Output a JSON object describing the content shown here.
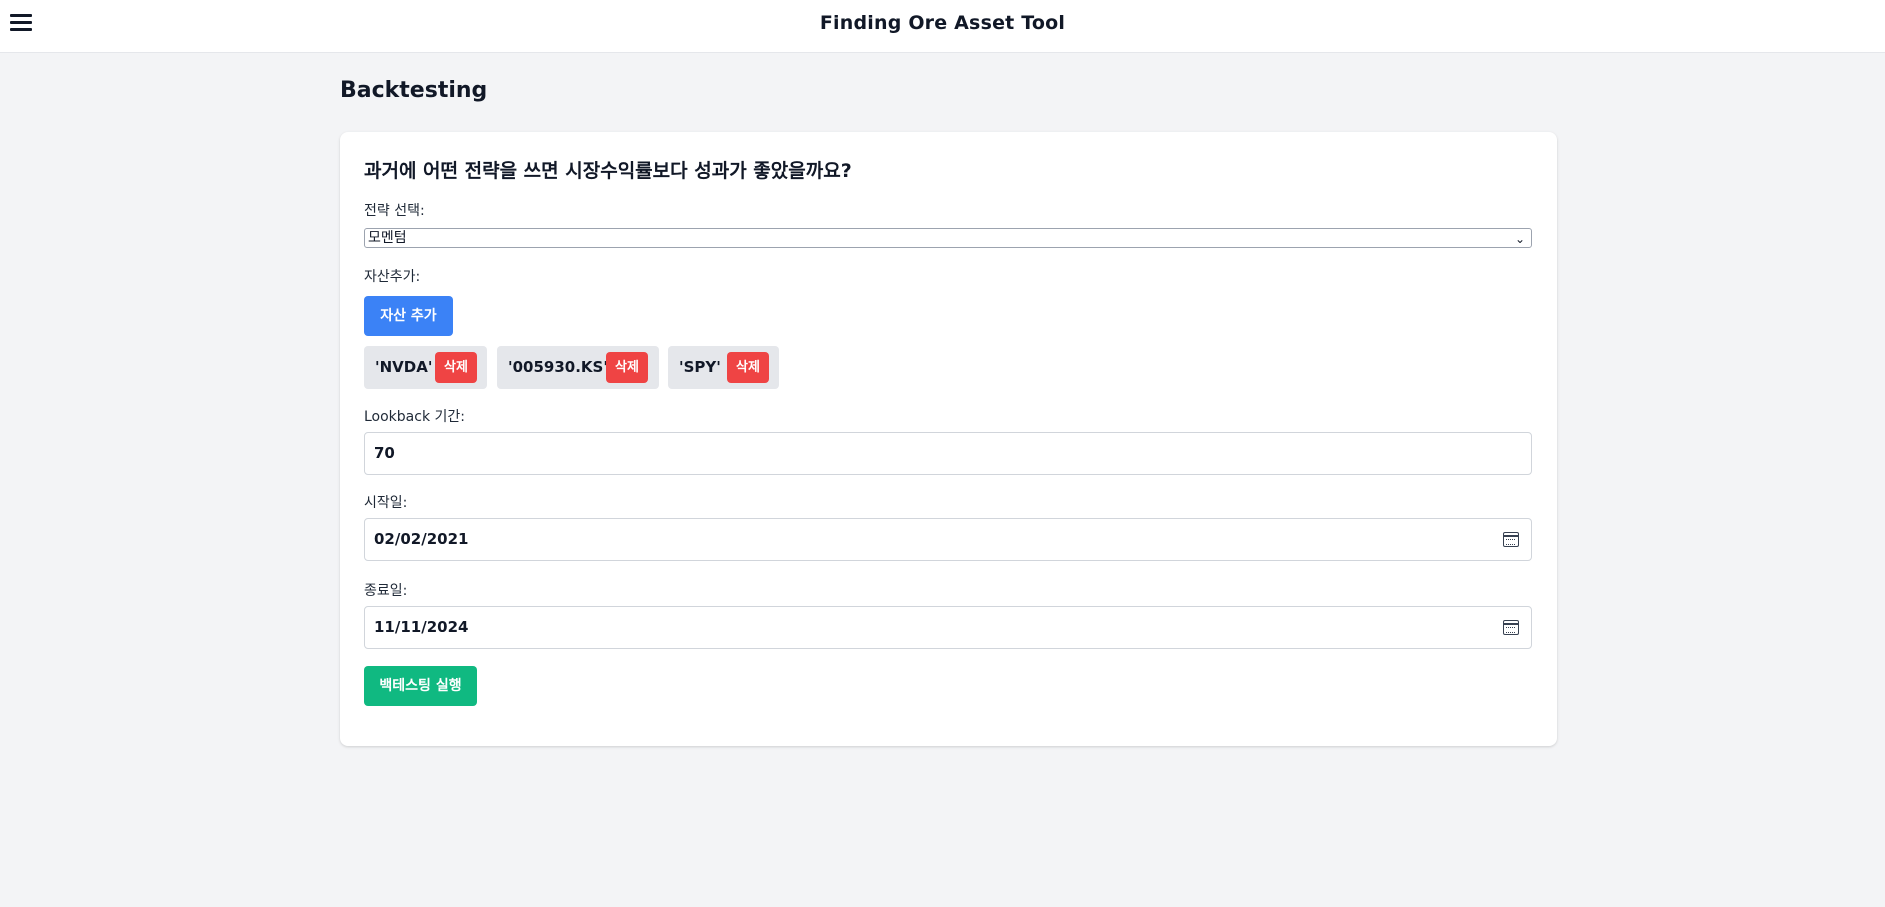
{
  "header": {
    "app_title": "Finding Ore Asset Tool"
  },
  "page": {
    "title": "Backtesting"
  },
  "form": {
    "heading": "과거에 어떤 전략을 쓰면 시장수익률보다 성과가 좋았을까요?",
    "strategy_label": "전략 선택:",
    "strategy_value": "모멘텀",
    "asset_label": "자산추가:",
    "add_asset_button": "자산 추가",
    "assets": [
      {
        "ticker": "'NVDA'",
        "delete_label": "삭제"
      },
      {
        "ticker": "'005930.KS'",
        "delete_label": "삭제"
      },
      {
        "ticker": "'SPY'",
        "delete_label": "삭제"
      }
    ],
    "lookback_label": "Lookback 기간:",
    "lookback_value": "70",
    "start_label": "시작일:",
    "start_value": "02/02/2021",
    "end_label": "종료일:",
    "end_value": "11/11/2024",
    "run_button": "백테스팅 실행"
  },
  "colors": {
    "primary_blue": "#3b82f6",
    "danger_red": "#ef4444",
    "success_green": "#10b981",
    "background": "#f3f4f6"
  }
}
